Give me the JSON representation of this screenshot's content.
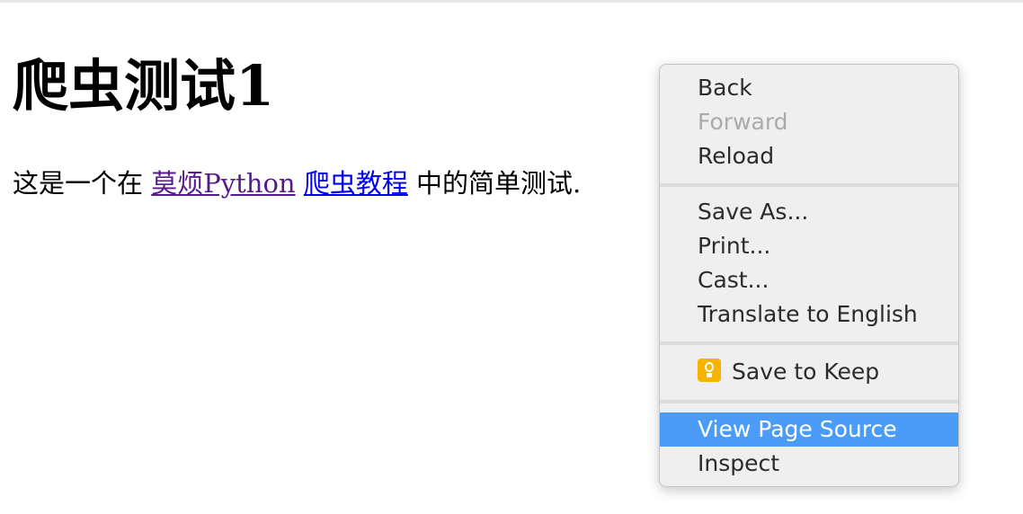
{
  "page": {
    "title": "爬虫测试1",
    "intro_prefix": "这是一个在 ",
    "link1_text": "莫烦Python",
    "link_gap": " ",
    "link2_text": "爬虫教程",
    "intro_suffix": " 中的简单测试."
  },
  "context_menu": {
    "back": "Back",
    "forward": "Forward",
    "reload": "Reload",
    "save_as": "Save As...",
    "print": "Print...",
    "cast": "Cast...",
    "translate": "Translate to English",
    "save_to_keep": "Save to Keep",
    "view_page_source": "View Page Source",
    "inspect": "Inspect",
    "keep_icon": "keep-lightbulb-icon",
    "highlight_color": "#4b9cf7"
  },
  "colors": {
    "visited_link": "#551a8b",
    "unvisited_link": "#0000ee",
    "keep_icon": "#f6b400"
  }
}
